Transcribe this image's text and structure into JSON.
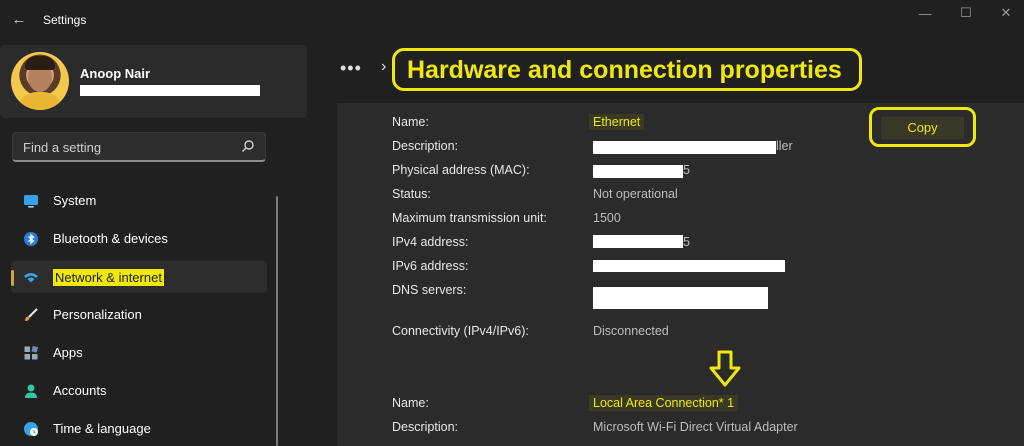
{
  "window": {
    "title": "Settings",
    "back_glyph": "←",
    "min_glyph": "—",
    "max_glyph": "☐",
    "close_glyph": "✕"
  },
  "profile": {
    "name": "Anoop Nair"
  },
  "search": {
    "placeholder": "Find a setting"
  },
  "sidebar": {
    "items": [
      {
        "label": "System",
        "icon": "monitor-icon"
      },
      {
        "label": "Bluetooth & devices",
        "icon": "bluetooth-icon"
      },
      {
        "label": "Network & internet",
        "icon": "wifi-icon",
        "active": true
      },
      {
        "label": "Personalization",
        "icon": "brush-icon"
      },
      {
        "label": "Apps",
        "icon": "apps-icon"
      },
      {
        "label": "Accounts",
        "icon": "person-icon"
      },
      {
        "label": "Time & language",
        "icon": "globe-clock-icon"
      }
    ]
  },
  "breadcrumb": {
    "more": "•••",
    "separator": "›",
    "title": "Hardware and connection properties"
  },
  "copy_label": "Copy",
  "adapters": [
    {
      "name_label": "Name:",
      "name": "Ethernet",
      "description_label": "Description:",
      "description_suffix": "ller",
      "mac_label": "Physical address (MAC):",
      "mac_suffix": "5",
      "status_label": "Status:",
      "status": "Not operational",
      "mtu_label": "Maximum transmission unit:",
      "mtu": "1500",
      "ipv4_label": "IPv4 address:",
      "ipv4_suffix": "5",
      "ipv6_label": "IPv6 address:",
      "dns_label": "DNS servers:",
      "connectivity_label": "Connectivity (IPv4/IPv6):",
      "connectivity": "Disconnected"
    },
    {
      "name_label": "Name:",
      "name": "Local Area Connection* 1",
      "description_label": "Description:",
      "description": "Microsoft Wi-Fi Direct Virtual Adapter"
    }
  ],
  "colors": {
    "highlight": "#f0e80a",
    "accent": "#d9a042",
    "background": "#202020",
    "panel": "#2b2b2b"
  }
}
